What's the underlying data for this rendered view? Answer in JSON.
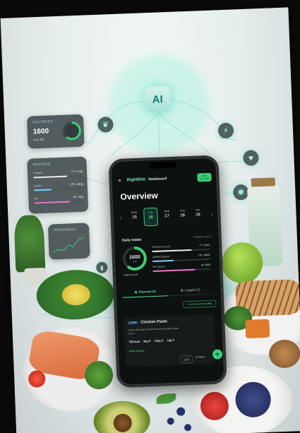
{
  "floating_panels": {
    "calories": {
      "title": "CALORIES",
      "value": "1600",
      "sub": "kcal left",
      "ring_fraction": 0.62
    },
    "macros": {
      "title": "MACROS",
      "rows": [
        {
          "name": "Protein",
          "value": "77 / 114g",
          "fraction": 0.68,
          "color": "#e8efed"
        },
        {
          "name": "Carbs",
          "value": "175 / 480g",
          "fraction": 0.36,
          "color": "#7ad0ff"
        },
        {
          "name": "Fat",
          "value": "62 / 85g",
          "fraction": 0.73,
          "color": "#e777c9"
        }
      ]
    },
    "progress": {
      "title": "PROGRESS"
    },
    "ai_badge": "AI"
  },
  "phone": {
    "brand": "RightBite",
    "section": "Dashboard",
    "kcal_badge": "1600 kcal left",
    "title": "Overview",
    "days": [
      {
        "name": "MON",
        "date": "15"
      },
      {
        "name": "TUE",
        "date": "16",
        "selected": true
      },
      {
        "name": "WED",
        "date": "17"
      },
      {
        "name": "THU",
        "date": "18"
      },
      {
        "name": "FRI",
        "date": "19"
      }
    ],
    "intake": {
      "title": "Daily Intake",
      "date": "TUESDAY, JUN 16",
      "ring_value": "1600",
      "ring_unit": "kcal",
      "left_text": "1400 kcal left",
      "ring_fraction": 0.62,
      "macros": [
        {
          "name": "PROTEIN 37g left",
          "value": "77 / 114G",
          "fraction": 0.68,
          "color": "#e8efed"
        },
        {
          "name": "CARBS 305g left",
          "value": "175 / 480G",
          "fraction": 0.36,
          "color": "#7ad0ff"
        },
        {
          "name": "FAT 23g left",
          "value": "62 / 85G",
          "fraction": 0.73,
          "color": "#e777c9"
        }
      ]
    },
    "tabs": [
      {
        "label": "Planned (4)",
        "active": true
      },
      {
        "label": "Logged (2)",
        "active": false
      }
    ],
    "log_custom": "+ LOG CUSTOM MEAL",
    "meal": {
      "badge": "DINNER",
      "name": "Chicken Pasta",
      "desc": "Pasta with grilled chicken breast and light tomato sauce.",
      "nutrients": [
        "750 kcal",
        "30g P",
        "120g C",
        "12g F"
      ],
      "details": "Show Details ⌄",
      "log": "LOG",
      "swap": "⇄ Swap"
    }
  },
  "colors": {
    "accent": "#3ccf78",
    "panel": "#323c3e"
  }
}
